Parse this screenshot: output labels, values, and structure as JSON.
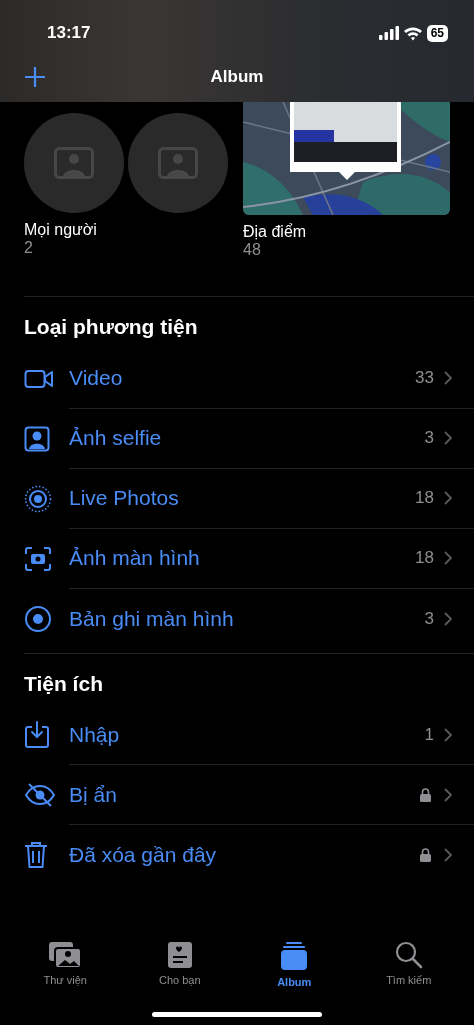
{
  "status_bar": {
    "time": "13:17",
    "battery": "65"
  },
  "nav": {
    "title": "Album"
  },
  "albums": [
    {
      "kind": "people",
      "title": "Mọi người",
      "count": "2"
    },
    {
      "kind": "places",
      "title": "Địa điểm",
      "count": "48"
    }
  ],
  "sections": [
    {
      "title": "Loại phương tiện",
      "items": [
        {
          "kind": "video",
          "label": "Video",
          "count": "33",
          "locked": false
        },
        {
          "kind": "selfie",
          "label": "Ảnh selfie",
          "count": "3",
          "locked": false
        },
        {
          "kind": "live",
          "label": "Live Photos",
          "count": "18",
          "locked": false
        },
        {
          "kind": "screenshot",
          "label": "Ảnh màn hình",
          "count": "18",
          "locked": false
        },
        {
          "kind": "recording",
          "label": "Bản ghi màn hình",
          "count": "3",
          "locked": false
        }
      ]
    },
    {
      "title": "Tiện ích",
      "items": [
        {
          "kind": "import",
          "label": "Nhập",
          "count": "1",
          "locked": false
        },
        {
          "kind": "hidden",
          "label": "Bị ẩn",
          "locked": true
        },
        {
          "kind": "deleted",
          "label": "Đã xóa gần đây",
          "locked": true
        }
      ]
    }
  ],
  "tabs": [
    {
      "kind": "library",
      "label": "Thư viện",
      "selected": false
    },
    {
      "kind": "foryou",
      "label": "Cho bạn",
      "selected": false
    },
    {
      "kind": "albums",
      "label": "Album",
      "selected": true
    },
    {
      "kind": "search",
      "label": "Tìm kiếm",
      "selected": false
    }
  ]
}
